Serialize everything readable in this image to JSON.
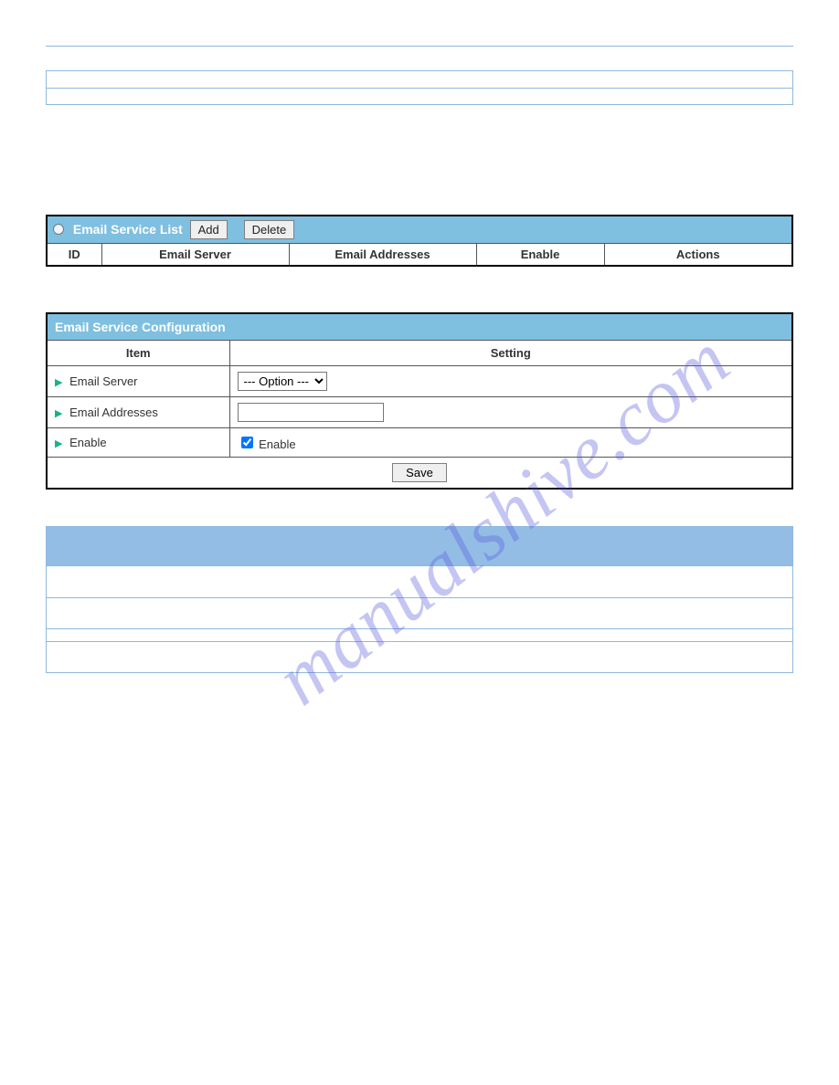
{
  "watermark": "manualshive.com",
  "list": {
    "title": "Email Service List",
    "add": "Add",
    "delete": "Delete",
    "columns": {
      "id": "ID",
      "server": "Email Server",
      "addresses": "Email Addresses",
      "enable": "Enable",
      "actions": "Actions"
    }
  },
  "cfg": {
    "title": "Email Service Configuration",
    "item": "Item",
    "setting": "Setting",
    "rows": {
      "server": "Email Server",
      "server_option": "--- Option ---",
      "addresses": "Email Addresses",
      "addresses_value": "",
      "enable_label": "Enable",
      "enable_text": "Enable",
      "enable_checked": true
    },
    "save": "Save"
  }
}
